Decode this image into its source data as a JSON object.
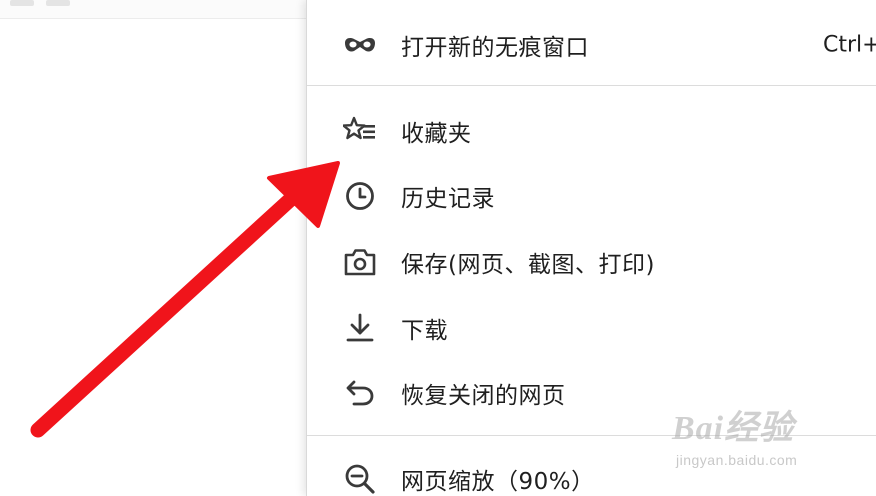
{
  "menu": {
    "items": [
      {
        "label": "打开新的无痕窗口",
        "shortcut": "Ctrl+",
        "icon": "incognito-mask-icon"
      },
      {
        "label": "收藏夹",
        "icon": "star-list-icon"
      },
      {
        "label": "历史记录",
        "icon": "clock-icon"
      },
      {
        "label": "保存(网页、截图、打印)",
        "icon": "camera-icon"
      },
      {
        "label": "下载",
        "icon": "download-icon"
      },
      {
        "label": "恢复关闭的网页",
        "icon": "undo-arrow-icon"
      },
      {
        "label": "网页缩放（90%）",
        "icon": "zoom-out-icon"
      }
    ]
  },
  "annotation": {
    "arrow_color": "#f0141b"
  },
  "watermark": {
    "brand": "Bai经验",
    "url": "jingyan.baidu.com"
  },
  "colors": {
    "menu_text": "#1f1f1f",
    "icon": "#3a3a3a",
    "separator": "#dcdcdc"
  }
}
